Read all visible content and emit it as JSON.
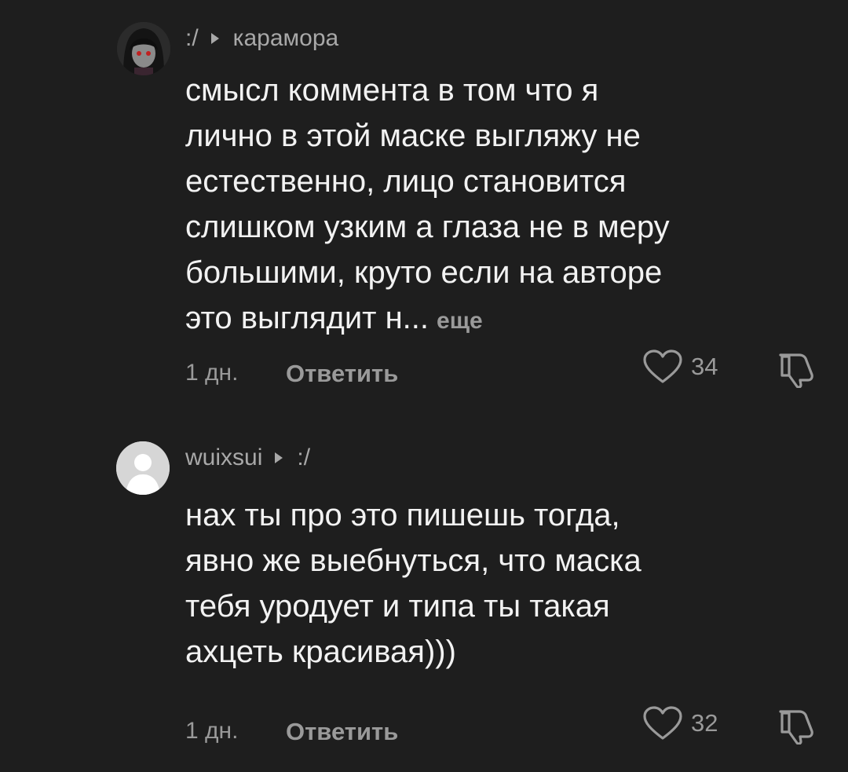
{
  "comments": [
    {
      "author": ":/",
      "reply_to": "карамора",
      "lines": [
        "смысл коммента в том что я",
        "лично в этой маске выгляжу не",
        "естественно, лицо становится",
        "слишком узким а глаза не в меру",
        "большими, круто если на авторе"
      ],
      "last_line": "это выглядит н...",
      "more_label": "еще",
      "time": "1 дн.",
      "reply_label": "Ответить",
      "likes": "34",
      "avatar_icon": "user-avatar-anime-icon"
    },
    {
      "author": "wuixsui",
      "reply_to": ":/",
      "lines": [
        "нах ты про это пишешь тогда,",
        "явно же выебнуться, что маска",
        "тебя уродует и типа ты такая",
        "ахцеть красивая)))"
      ],
      "time": "1 дн.",
      "reply_label": "Ответить",
      "likes": "32",
      "avatar_icon": "default-avatar-icon"
    }
  ],
  "colors": {
    "background": "#1e1e1e",
    "text": "#f2f2f2",
    "muted": "#9a9a9a"
  }
}
